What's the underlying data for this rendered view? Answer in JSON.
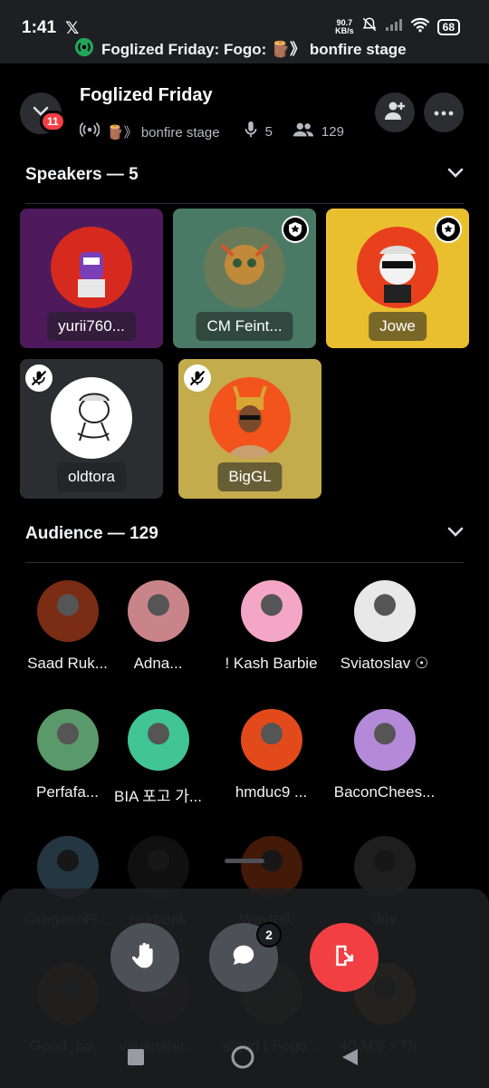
{
  "status_bar": {
    "time": "1:41",
    "x_logo": "𝕏",
    "net_speed": "90.7",
    "net_unit": "KB/s",
    "battery": "68",
    "stage_banner": "Foglized Friday: Fogo: 🪵》 bonfire stage"
  },
  "header": {
    "title": "Foglized Friday",
    "stage_name": "🪵》 bonfire stage",
    "speaker_count": "5",
    "listener_count": "129",
    "back_badge": "11"
  },
  "speakers": {
    "label": "Speakers — 5",
    "tiles": [
      {
        "name": "yurii760...",
        "tile_color": "#4e1a5c",
        "avatar_color": "#d62a1e"
      },
      {
        "name": "CM Feint...",
        "tile_color": "#4a7a66",
        "avatar_color": "#6a7a58"
      },
      {
        "name": "Jowe",
        "tile_color": "#e9bf2f",
        "avatar_color": "#e8401c"
      },
      {
        "name": "oldtora",
        "tile_color": "#2b2d31",
        "avatar_color": "#ffffff"
      },
      {
        "name": "BigGL",
        "tile_color": "#c4ab4c",
        "avatar_color": "#f2541b"
      }
    ]
  },
  "audience": {
    "label": "Audience — 129",
    "members": [
      {
        "name": "Saad Ruk...",
        "color": "#7a2c14"
      },
      {
        "name": "Adna...",
        "color": "#c9848a"
      },
      {
        "name": "! Kash Barbie",
        "color": "#f3a6c6"
      },
      {
        "name": "Sviatoslav ☉",
        "color": "#e8e8e8"
      },
      {
        "name": "Perfafa...",
        "color": "#5a9a6a"
      },
      {
        "name": "BIA 포고 가...",
        "color": "#41c597"
      },
      {
        "name": "hmduc9 ...",
        "color": "#e24a1b"
      },
      {
        "name": "BaconChees...",
        "color": "#b48ad8"
      },
      {
        "name": "OreganoFl...",
        "color": "#7fc1e8"
      },
      {
        "name": "rickpeak",
        "color": "#3a3a3a"
      },
      {
        "name": "Waytoff...",
        "color": "#f05a1e"
      },
      {
        "name": "dov",
        "color": "#6b6b6b"
      },
      {
        "name": "Good_bo...",
        "color": "#c06a30"
      },
      {
        "name": "vaulinahit...",
        "color": "#5a4a3a"
      },
      {
        "name": "slged | Fogo...",
        "color": "#3f8a3f"
      },
      {
        "name": "40 MS ⚡Th...",
        "color": "#e8b93a"
      }
    ]
  },
  "controls": {
    "chat_badge": "2",
    "raise_hand_color": "#4e5058",
    "chat_color": "#4e5058",
    "leave_color": "#f23f43"
  }
}
